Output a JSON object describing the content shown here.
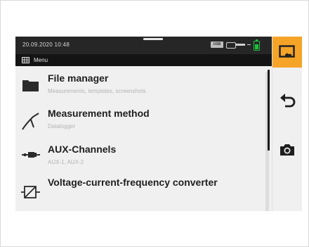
{
  "status": {
    "datetime": "20.09.2020  10:48",
    "usb_badge": "USB"
  },
  "titlebar": {
    "icon": "grid-menu-icon",
    "title": "Menu"
  },
  "menu": {
    "items": [
      {
        "title": "File manager",
        "subtitle": "Measurements, templates, screenshots",
        "icon": "folder-icon"
      },
      {
        "title": "Measurement method",
        "subtitle": "Datalogger",
        "icon": "measurement-needle-icon"
      },
      {
        "title": "AUX-Channels",
        "subtitle": "AUX-1, AUX-2",
        "icon": "aux-plug-icon"
      },
      {
        "title": "Voltage-current-frequency converter",
        "subtitle": "",
        "icon": "converter-icon"
      }
    ]
  },
  "sidebar": {
    "buttons": [
      {
        "name": "export",
        "icon": "export-icon"
      },
      {
        "name": "back",
        "icon": "back-arrow-icon"
      },
      {
        "name": "screenshot",
        "icon": "camera-icon"
      }
    ]
  },
  "colors": {
    "accent": "#f5a428",
    "statusbar": "#262626",
    "titlebar": "#141414",
    "battery": "#1fbf3f"
  }
}
